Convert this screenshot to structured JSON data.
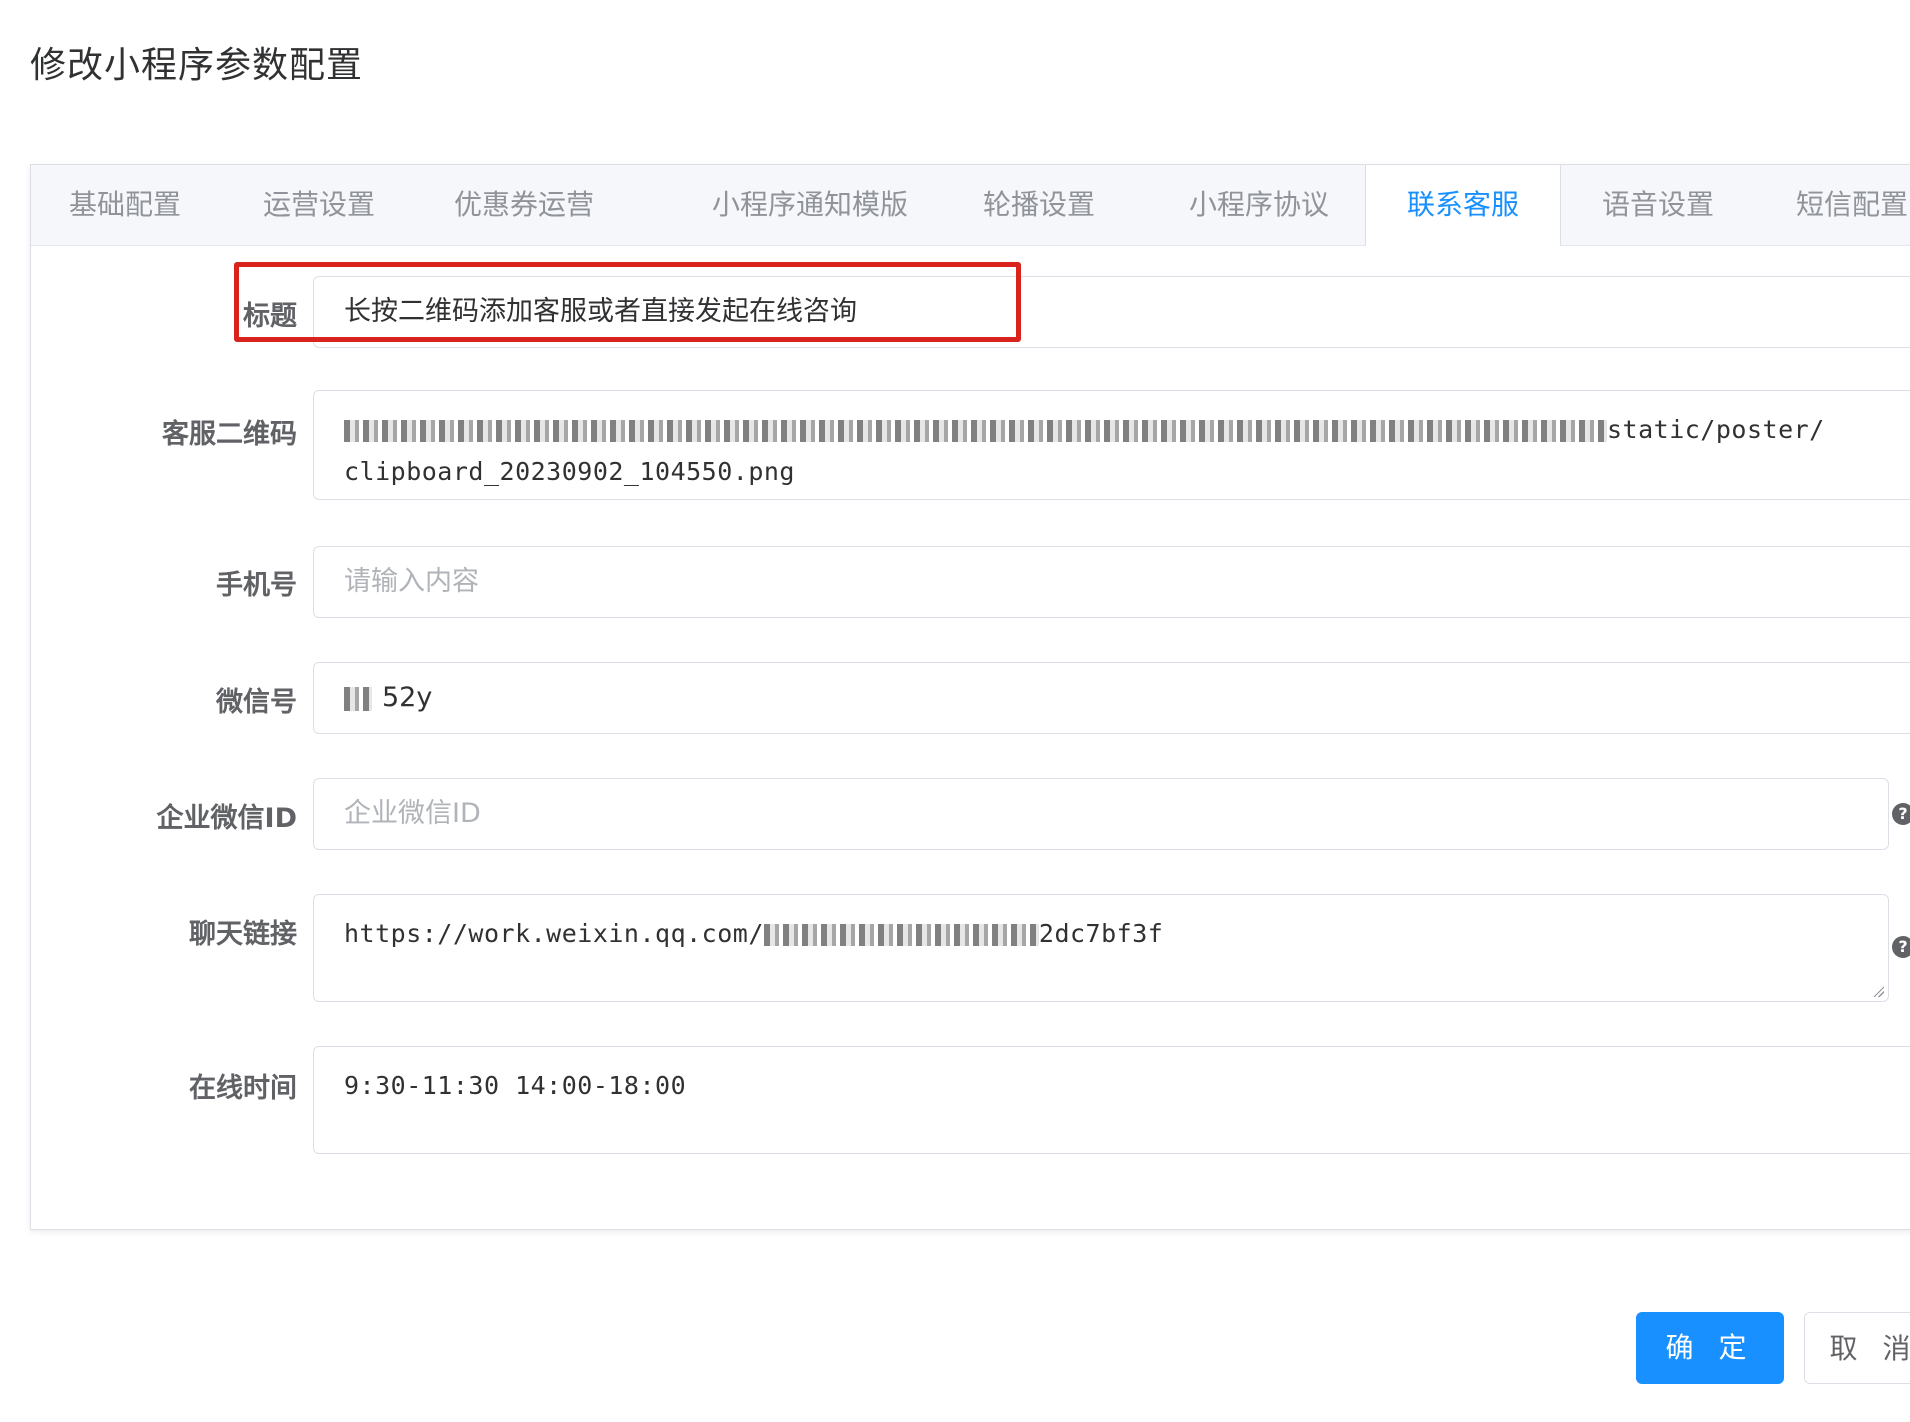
{
  "dialog": {
    "title": "修改小程序参数配置"
  },
  "tabs": [
    {
      "label": "基础配置"
    },
    {
      "label": "运营设置"
    },
    {
      "label": "优惠券运营"
    },
    {
      "label": "小程序通知模版"
    },
    {
      "label": "轮播设置"
    },
    {
      "label": "小程序协议"
    },
    {
      "label": "联系客服"
    },
    {
      "label": "语音设置"
    },
    {
      "label": "短信配置"
    }
  ],
  "active_tab": "联系客服",
  "form": {
    "title": {
      "label": "标题",
      "value": "长按二维码添加客服或者直接发起在线咨询"
    },
    "qrcode": {
      "label": "客服二维码",
      "value_line1_tail": "static/poster/",
      "value_line2": "clipboard_20230902_104550.png"
    },
    "phone": {
      "label": "手机号",
      "placeholder": "请输入内容"
    },
    "wechat": {
      "label": "微信号",
      "value_tail": "52y"
    },
    "corp_wechat_id": {
      "label": "企业微信ID",
      "placeholder": "企业微信ID"
    },
    "chat_link": {
      "label": "聊天链接",
      "value_head": "https://work.weixin.qq.com/",
      "value_tail": "2dc7bf3f"
    },
    "online_time": {
      "label": "在线时间",
      "value": "9:30-11:30 14:00-18:00"
    }
  },
  "buttons": {
    "confirm": "确 定",
    "cancel": "取 消"
  },
  "colors": {
    "primary": "#1890ff",
    "highlight": "#d9231d"
  }
}
